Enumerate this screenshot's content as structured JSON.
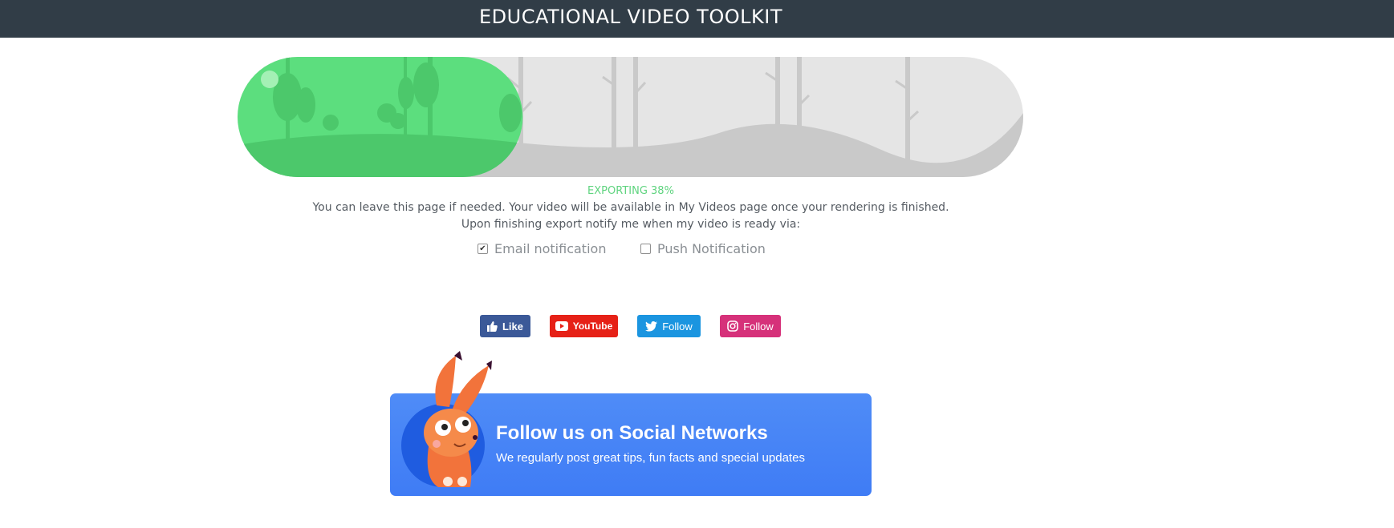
{
  "header": {
    "title": "EDUCATIONAL VIDEO TOOLKIT"
  },
  "export": {
    "status_text": "EXPORTING 38%",
    "progress_fraction": 0.38,
    "message": "You can leave this page if needed. Your video will be available in My Videos page once your rendering is finished.",
    "notify_prompt": "Upon finishing export notify me when my video is ready via:"
  },
  "notifications": {
    "email": {
      "label": "Email notification",
      "checked": true
    },
    "push": {
      "label": "Push Notification",
      "checked": false
    }
  },
  "social_buttons": {
    "facebook": {
      "label": "Like",
      "color": "#3b5998",
      "icon": "thumbs-up-icon"
    },
    "youtube": {
      "label": "YouTube",
      "color": "#e62117",
      "icon": "youtube-play-icon"
    },
    "twitter": {
      "label": "Follow",
      "color": "#1b95e0",
      "icon": "twitter-bird-icon"
    },
    "instagram": {
      "label": "Follow",
      "color": "#d6317a",
      "icon": "instagram-icon"
    }
  },
  "promo": {
    "heading": "Follow us on Social Networks",
    "subtext": "We regularly post great tips, fun facts and special updates"
  },
  "colors": {
    "header_bg": "#313d47",
    "progress_green": "#5cde7e",
    "progress_track": "#e5e5e5",
    "promo_blue": "#4a86f6"
  }
}
